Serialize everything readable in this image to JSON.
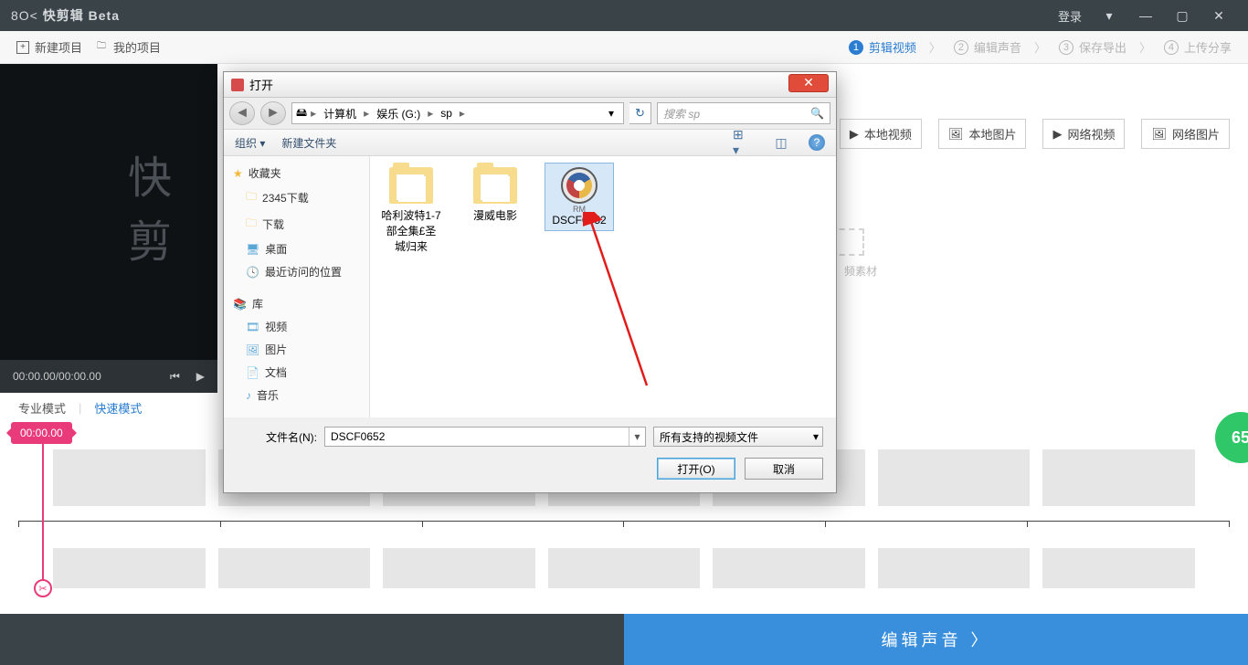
{
  "title": "快剪辑 Beta",
  "login": "登录",
  "topbar": {
    "new_project": "新建项目",
    "my_projects": "我的项目"
  },
  "steps": {
    "s1": "剪辑视频",
    "s2": "编辑声音",
    "s3": "保存导出",
    "s4": "上传分享"
  },
  "preview": {
    "watermark": "快剪",
    "time": "00:00.00/00:00.00"
  },
  "import_tabs": {
    "t1": "本地视频",
    "t2": "本地图片",
    "t3": "网络视频",
    "t4": "网络图片"
  },
  "placeholder_hint": "频素材",
  "modes": {
    "pro": "专业模式",
    "fast": "快速模式"
  },
  "timeline_marker": "00:00.00",
  "badge": "65",
  "bottom_action": "编辑声音",
  "dialog": {
    "title": "打开",
    "path": {
      "p1": "计算机",
      "p2": "娱乐 (G:)",
      "p3": "sp"
    },
    "search_placeholder": "搜索 sp",
    "toolbar": {
      "org": "组织",
      "newf": "新建文件夹"
    },
    "tree": {
      "fav": "收藏夹",
      "dl2345": "2345下载",
      "dl": "下载",
      "desk": "桌面",
      "recent": "最近访问的位置",
      "lib": "库",
      "video": "视频",
      "pic": "图片",
      "doc": "文档",
      "music": "音乐"
    },
    "files": {
      "f1": "哈利波特1-7部全集£圣城归来",
      "f2": "漫威电影",
      "f3": "DSCF0652",
      "f3_tag": "RM"
    },
    "filename_label": "文件名(N):",
    "filename_value": "DSCF0652",
    "filter": "所有支持的视频文件",
    "open_btn": "打开(O)",
    "cancel_btn": "取消"
  }
}
